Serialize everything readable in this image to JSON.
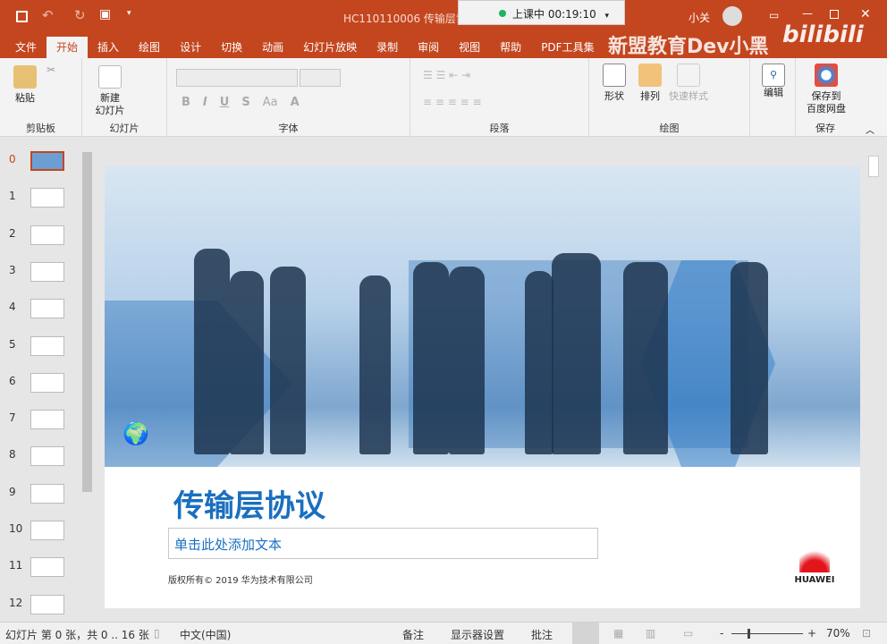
{
  "titlebar": {
    "doc_title": "HC110110006 传输层协",
    "meeting_status": "上课中 00:19:10",
    "user": "小关",
    "watermark": "新盟教育Dev小黑",
    "bilibili": "bilibili"
  },
  "tabs": [
    "文件",
    "开始",
    "插入",
    "绘图",
    "设计",
    "切换",
    "动画",
    "幻灯片放映",
    "录制",
    "审阅",
    "视图",
    "帮助",
    "PDF工具集"
  ],
  "ribbon": {
    "clipboard": {
      "paste": "粘贴",
      "label": "剪贴板"
    },
    "slides": {
      "new_slide_1": "新建",
      "new_slide_2": "幻灯片",
      "label": "幻灯片"
    },
    "font": {
      "label": "字体",
      "bold": "B",
      "italic": "I",
      "underline": "U",
      "strike": "S",
      "case": "Aa",
      "color": "A"
    },
    "paragraph": {
      "label": "段落"
    },
    "drawing": {
      "shapes": "形状",
      "arrange": "排列",
      "quick_styles": "快速样式",
      "label": "绘图"
    },
    "editing": {
      "edit": "编辑"
    },
    "save": {
      "save_1": "保存到",
      "save_2": "百度网盘",
      "label": "保存"
    }
  },
  "thumbnails": [
    "0",
    "1",
    "2",
    "3",
    "4",
    "5",
    "6",
    "7",
    "8",
    "9",
    "10",
    "11",
    "12"
  ],
  "slide": {
    "title": "传输层协议",
    "subtitle_placeholder": "单击此处添加文本",
    "copyright": "版权所有© 2019 华为技术有限公司",
    "logo": "HUAWEI"
  },
  "status": {
    "slide_info": "幻灯片 第 0 张，共 0 .. 16 张",
    "language": "中文(中国)",
    "notes": "备注",
    "display": "显示器设置",
    "comments": "批注",
    "zoom": "70%",
    "zoom_minus": "-",
    "zoom_plus": "+"
  },
  "colors": {
    "brand": "#c4461f",
    "title_blue": "#1a6fc0"
  }
}
